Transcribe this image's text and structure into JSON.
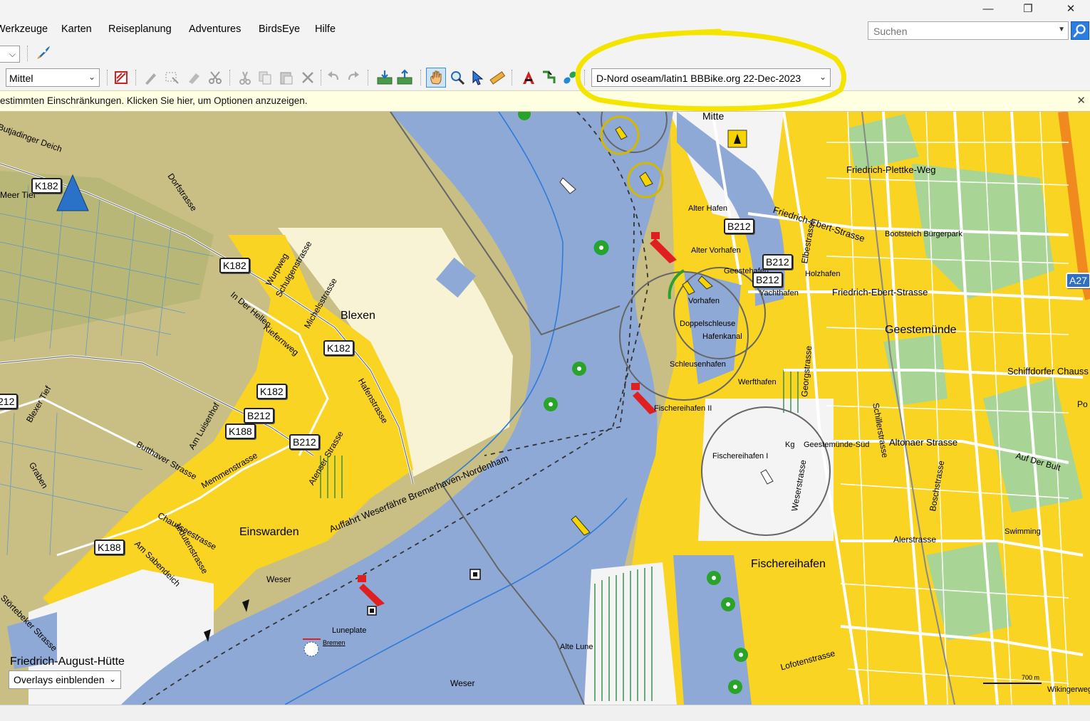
{
  "window": {
    "minimize_icon": "minimize-icon",
    "maximize_icon": "restore-icon",
    "close_icon": "close-icon"
  },
  "menu": {
    "items": [
      "Werkzeuge",
      "Karten",
      "Reiseplanung",
      "Adventures",
      "BirdsEye",
      "Hilfe"
    ]
  },
  "search": {
    "placeholder": "Suchen",
    "button_icon": "search-icon"
  },
  "toolbar": {
    "detail_level": "Mittel",
    "map_product": "D-Nord oseam/latin1 BBBike.org 22-Dec-2023"
  },
  "infobar": {
    "text": "estimmten Einschränkungen. Klicken Sie hier, um Optionen anzuzeigen."
  },
  "map": {
    "labels": {
      "blexen": "Blexen",
      "einswarden": "Einswarden",
      "friedrich_august": "Friedrich-August-Hütte",
      "mitte": "Mitte",
      "geestemuende": "Geestemünde",
      "fischereihafen": "Fischereihafen",
      "alter_hafen": "Alter Hafen",
      "alter_vorhafen": "Alter Vorhafen",
      "geestehafen": "Geestehafen",
      "holzhafen": "Holzhafen",
      "yachthafen": "Yachthafen",
      "vorhafen": "Vorhafen",
      "doppelschleuse": "Doppelschleuse",
      "hafenkanal": "Hafenkanal",
      "schleusenhafen": "Schleusenhafen",
      "werfthafen": "Werfthafen",
      "fischereihafen_ii": "Fischereihafen II",
      "fischereihafen_i": "Fischereihafen I",
      "geestemuende_sued": "Geestemünde-Süd",
      "weser1": "Weser",
      "weser2": "Weser",
      "luneplate": "Luneplate",
      "bremen": "Bremen",
      "alte_lune": "Alte Lune",
      "faehre": "Auffahrt Weserfähre Bremerhaven-Nordenham",
      "friedrich_plettke": "Friedrich-Plettke-Weg",
      "friedrich_ebert1": "Friedrich-Ebert-Strasse",
      "friedrich_ebert2": "Friedrich-Ebert-Strasse",
      "bootsteich": "Bootsteich Bürgerpark",
      "altonaer": "Altonaer Strasse",
      "schiffdorfer": "Schiffdorfer Chauss",
      "auf_der_bult": "Auf Der Bult",
      "alerstrasse": "Alerstrasse",
      "swimming": "Swimming",
      "weserstrasse": "Weserstrasse",
      "georgstrasse": "Georgstrasse",
      "elbestrasse": "Elbestrasse",
      "schillerstrasse": "Schillerstrasse",
      "boschstrasse": "Boschstrasse",
      "lofotenstrasse": "Lofotenstrasse",
      "kg": "Kg",
      "wurpweg": "Wurpweg",
      "schulgenstrasse": "Schulgenstrasse",
      "in_der_hellen": "In Der Hellen",
      "kiefernweg": "Kiefernweg",
      "michelsstrasse": "Michelsstrasse",
      "butjadinger": "Butjadinger Deich",
      "dorfstrasse": "Dorfstrasse",
      "meerstrasse": "Meer Tief",
      "blexer_tief": "Blexer Tief",
      "buttlaer": "Butthaver Strasse",
      "am_luisenhof": "Am Luisenhof",
      "hafenstrasse": "Hafenstrasse",
      "grabenweg": "Graben",
      "chaussee": "Chausseestrasse",
      "jeddeloher": "Jedutenstrasse",
      "am_sabendeich": "Am Sabendeich",
      "stoerebeker": "Störtebeker Strasse",
      "atenserstrasse": "Atenser Strasse",
      "memmerstrasse": "Memmenstrasse",
      "scale": "700 m",
      "wikingerweg": "Wikingerweg",
      "po": "Po"
    },
    "road_signs": [
      "K182",
      "K182",
      "K182",
      "K182",
      "B212",
      "K188",
      "B212",
      "B212",
      "B212",
      "B212",
      "K188",
      "A27",
      "212"
    ],
    "overlay_combo": "Overlays einblenden",
    "colors": {
      "water": "#8fa9d6",
      "urban": "#f9d423",
      "land": "#c9bf84",
      "green": "#9fd28a"
    }
  }
}
